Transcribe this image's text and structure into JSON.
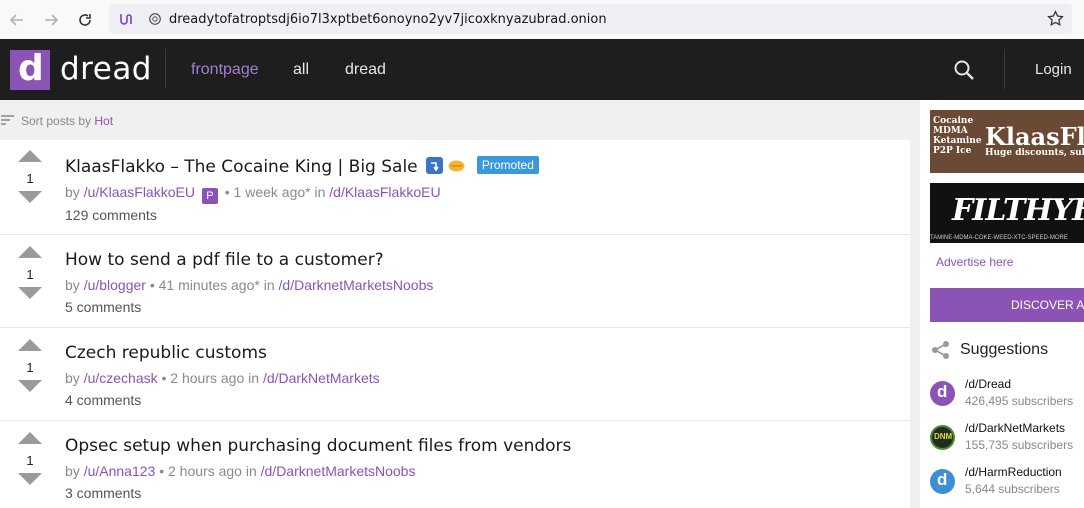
{
  "browser": {
    "url": "dreadytofatroptsdj6io7l3xptbet6onoyno2yv7jicoxknyazubrad.onion"
  },
  "header": {
    "logo_letter": "d",
    "site_name": "dread",
    "nav": [
      "frontpage",
      "all",
      "dread"
    ],
    "login": "Login"
  },
  "sort": {
    "label": "Sort posts by",
    "value": "Hot"
  },
  "posts": [
    {
      "votes": "1",
      "title": "KlaasFlakko – The Cocaine King | Big Sale",
      "promoted": "Promoted",
      "by": "by",
      "user": "/u/KlaasFlakkoEU",
      "badge": "P",
      "time": "• 1 week ago* in",
      "sub": "/d/KlaasFlakkoEU",
      "comments": "129 comments"
    },
    {
      "votes": "1",
      "title": "How to send a pdf file to a customer?",
      "by": "by",
      "user": "/u/blogger",
      "time": "• 41 minutes ago* in",
      "sub": "/d/DarknetMarketsNoobs",
      "comments": "5 comments"
    },
    {
      "votes": "1",
      "title": "Czech republic customs",
      "by": "by",
      "user": "/u/czechask",
      "time": "• 2 hours ago in",
      "sub": "/d/DarkNetMarkets",
      "comments": "4 comments"
    },
    {
      "votes": "1",
      "title": "Opsec setup when purchasing document files from vendors",
      "by": "by",
      "user": "/u/Anna123",
      "time": "• 2 hours ago in",
      "sub": "/d/DarknetMarketsNoobs",
      "comments": "3 comments"
    }
  ],
  "sidebar": {
    "ad1": {
      "small": [
        "Cocaine",
        "MDMA",
        "Ketamine",
        "P2P Ice"
      ],
      "big": "KlaasFl",
      "sub": "Huge discounts, subscr"
    },
    "ad2": {
      "big": "FILTHYFE",
      "sub": "TAMINE-MDMA-COKE-WEED-XTC-SPEED-MORE"
    },
    "advertise": "Advertise here",
    "discover": "DISCOVER AR",
    "suggestions_title": "Suggestions",
    "suggestions": [
      {
        "name": "/d/Dread",
        "subs": "426,495 subscribers",
        "color": "#8c53b6"
      },
      {
        "name": "/d/DarkNetMarkets",
        "subs": "155,735 subscribers",
        "color": "#1f2e1f"
      },
      {
        "name": "/d/HarmReduction",
        "subs": "5,644 subscribers",
        "color": "#3b8fd6"
      }
    ]
  }
}
